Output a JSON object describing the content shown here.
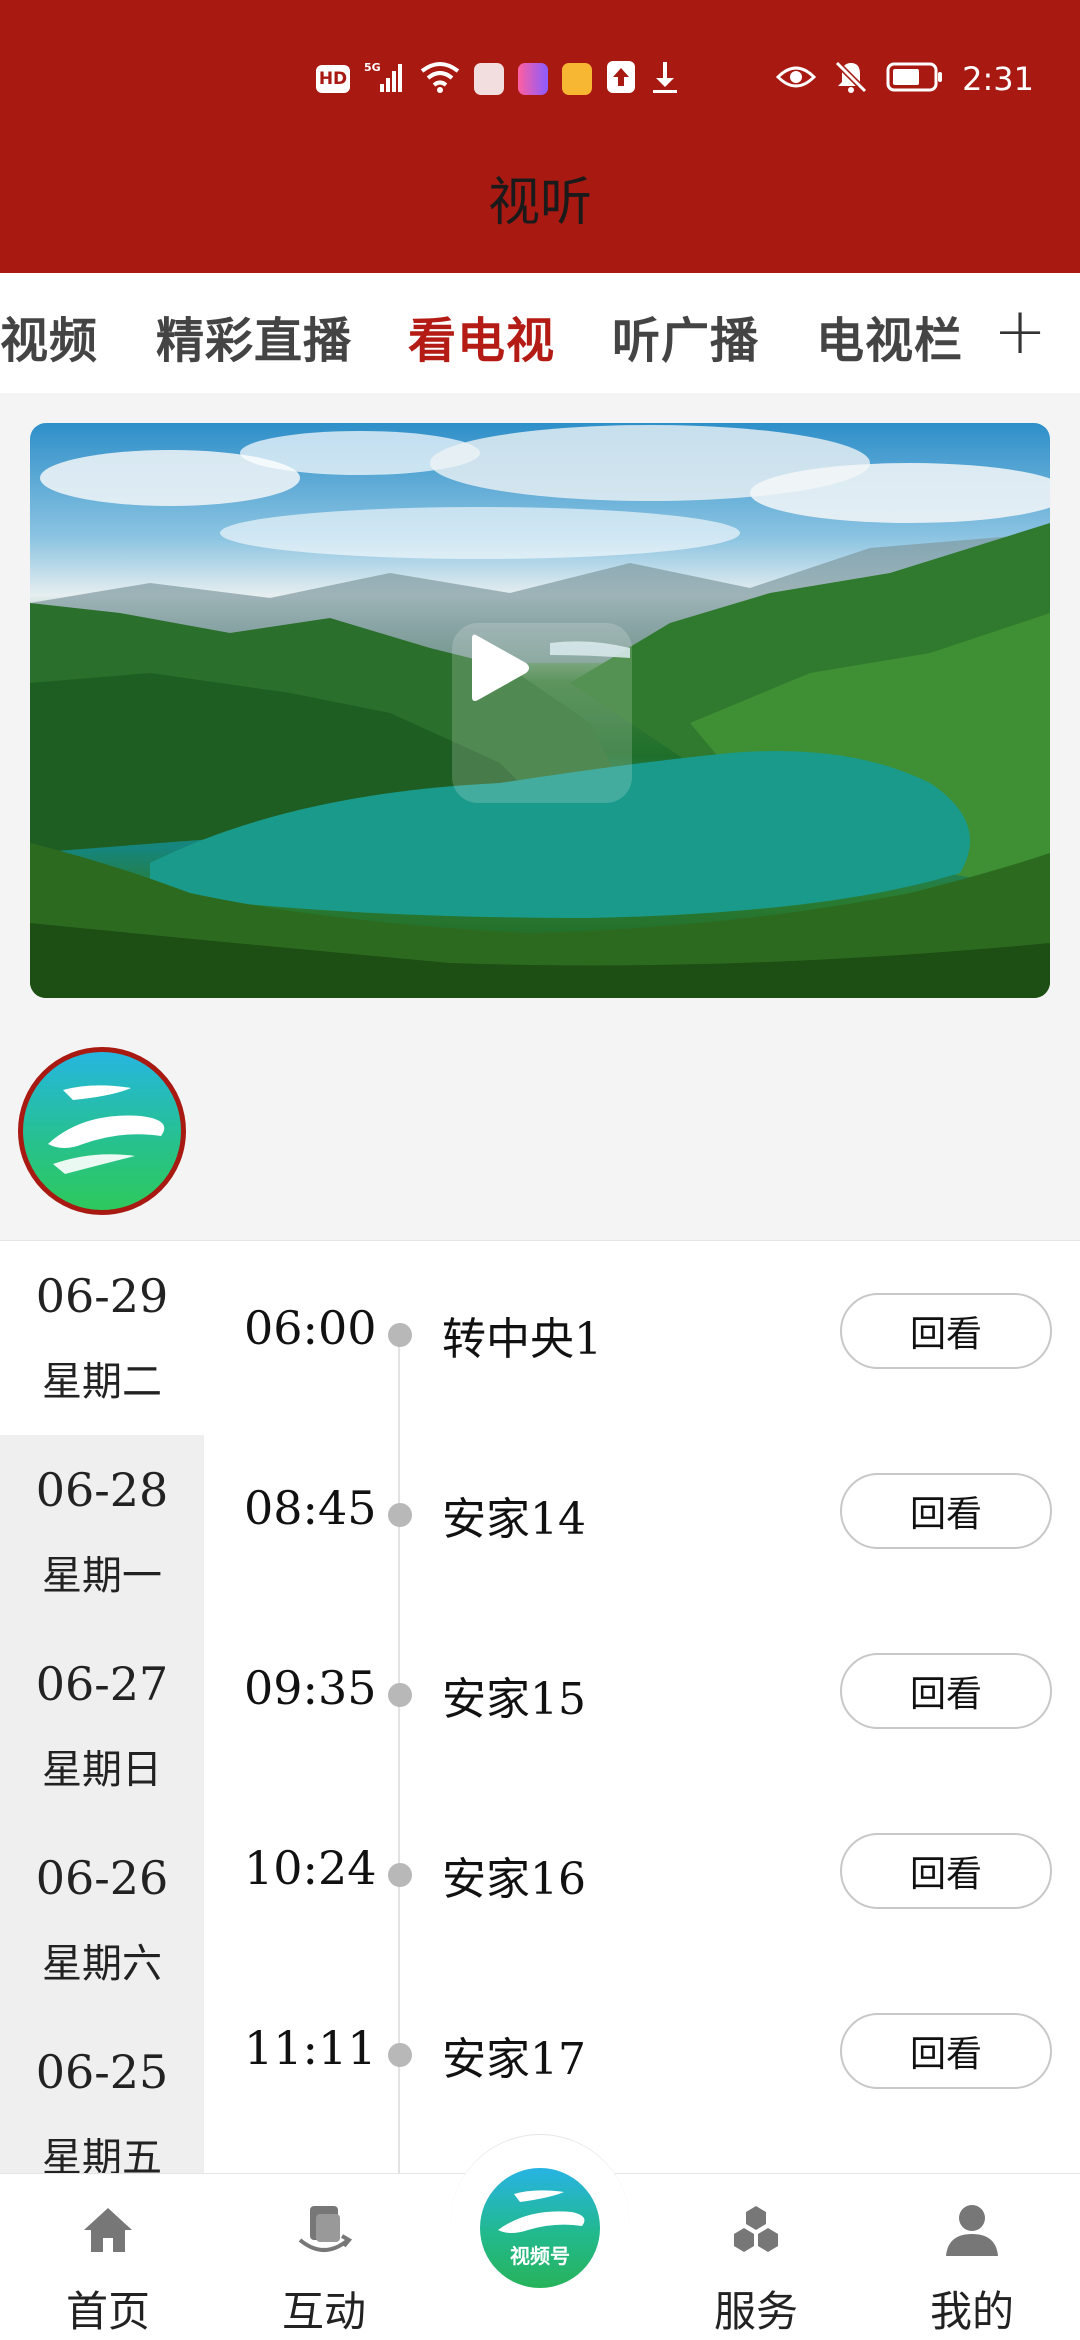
{
  "status_bar": {
    "time": "2:31",
    "hd_label": "HD",
    "network": "5G",
    "left_icons": [
      "hd-icon",
      "signal-icon",
      "wifi-icon",
      "mail-icon",
      "app-icon",
      "app-icon",
      "upload-icon",
      "download-icon"
    ],
    "right_icons": [
      "eye-icon",
      "bell-off-icon",
      "battery-icon"
    ]
  },
  "header": {
    "title": "视听",
    "bg_color": "#a81912"
  },
  "tabs": {
    "items": [
      {
        "label": "视频",
        "active": false
      },
      {
        "label": "精彩直播",
        "active": false
      },
      {
        "label": "看电视",
        "active": true
      },
      {
        "label": "听广播",
        "active": false
      },
      {
        "label": "电视栏",
        "active": false
      }
    ],
    "add_label": "+",
    "active_color": "#b31b14"
  },
  "video": {
    "play_icon": "play-icon"
  },
  "channel": {
    "logo_icon": "channel-logo-icon"
  },
  "schedule": {
    "dates": [
      {
        "date": "06-29",
        "weekday": "星期二",
        "active": true
      },
      {
        "date": "06-28",
        "weekday": "星期一",
        "active": false
      },
      {
        "date": "06-27",
        "weekday": "星期日",
        "active": false
      },
      {
        "date": "06-26",
        "weekday": "星期六",
        "active": false
      },
      {
        "date": "06-25",
        "weekday": "星期五",
        "active": false
      }
    ],
    "programs": [
      {
        "time": "06:00",
        "title": "转中央1",
        "action": "回看"
      },
      {
        "time": "08:45",
        "title": "安家14",
        "action": "回看"
      },
      {
        "time": "09:35",
        "title": "安家15",
        "action": "回看"
      },
      {
        "time": "10:24",
        "title": "安家16",
        "action": "回看"
      },
      {
        "time": "11:11",
        "title": "安家17",
        "action": "回看"
      }
    ]
  },
  "bottom_nav": {
    "items": [
      {
        "label": "首页",
        "icon": "home-icon"
      },
      {
        "label": "互动",
        "icon": "interact-icon"
      },
      {
        "label": "服务",
        "icon": "service-icon"
      },
      {
        "label": "我的",
        "icon": "user-icon"
      }
    ],
    "center_label": "视频号"
  }
}
